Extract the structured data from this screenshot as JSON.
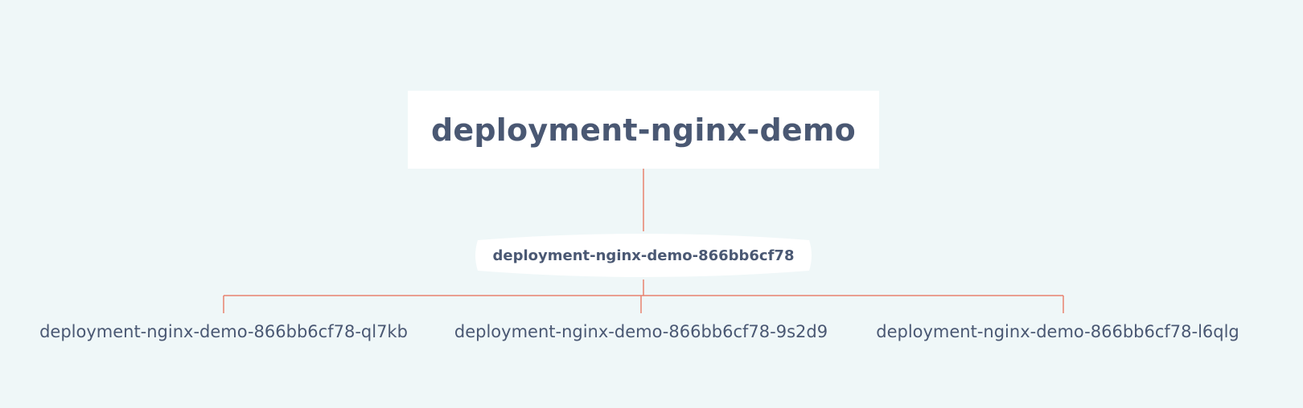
{
  "diagram": {
    "root": {
      "label": "deployment-nginx-demo"
    },
    "replicaset": {
      "label": "deployment-nginx-demo-866bb6cf78"
    },
    "pods": [
      {
        "label": "deployment-nginx-demo-866bb6cf78-ql7kb"
      },
      {
        "label": "deployment-nginx-demo-866bb6cf78-9s2d9"
      },
      {
        "label": "deployment-nginx-demo-866bb6cf78-l6qlg"
      }
    ],
    "colors": {
      "background": "#eff7f8",
      "node_fill": "#ffffff",
      "text": "#4a5873",
      "connector": "#e8826f"
    }
  }
}
